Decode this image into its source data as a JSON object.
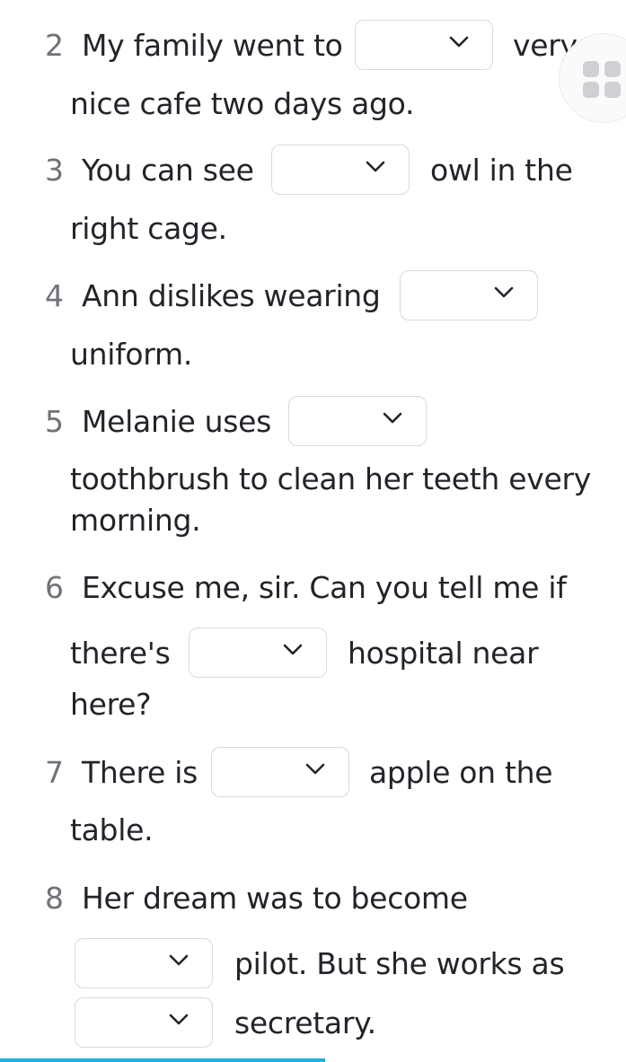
{
  "exercise": {
    "items": [
      {
        "number": "2",
        "before": "My family went to",
        "after": "very",
        "line2": "nice cafe two days ago.",
        "selected": ""
      },
      {
        "number": "3",
        "before": "You can see",
        "after": "owl in the",
        "line2": "right cage.",
        "selected": ""
      },
      {
        "number": "4",
        "before": "Ann dislikes wearing",
        "after": "",
        "line2": "uniform.",
        "selected": ""
      },
      {
        "number": "5",
        "before": "Melanie uses",
        "after": "",
        "line2": "toothbrush to clean her teeth every",
        "line3": "morning.",
        "selected": ""
      },
      {
        "number": "6",
        "before": "Excuse me, sir. Can you tell me if",
        "line2_before": "there's",
        "line2_after": "hospital near",
        "line3": "here?",
        "selected": ""
      },
      {
        "number": "7",
        "before": "There is",
        "after": "apple on the",
        "line2": "table.",
        "selected": ""
      },
      {
        "number": "8",
        "before": "Her dream was to become",
        "line2_after": "pilot. But she works as",
        "line3_after": "secretary.",
        "selected_a": "",
        "selected_b": ""
      }
    ]
  },
  "icons": {
    "dropdown": "chevron-down-icon",
    "menu": "grid-menu-icon"
  },
  "colors": {
    "text": "#22242a",
    "number": "#6f7378",
    "border": "#d7d9de",
    "progress": "#1fb0e0"
  },
  "progress": {
    "fraction": 0.52
  }
}
